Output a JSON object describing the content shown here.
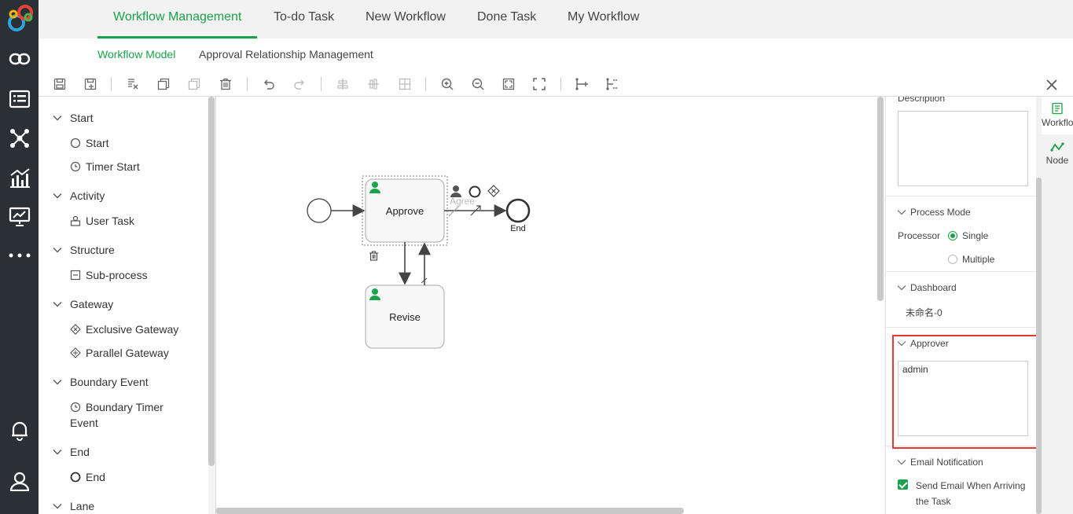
{
  "nav": {
    "tabs": [
      "Workflow Management",
      "To-do Task",
      "New Workflow",
      "Done Task",
      "My Workflow"
    ],
    "active_tab": "Workflow Management",
    "subtabs": [
      "Workflow Model",
      "Approval Relationship Management"
    ]
  },
  "palette": {
    "groups": [
      {
        "label": "Start",
        "items": [
          "Start",
          "Timer Start"
        ]
      },
      {
        "label": "Activity",
        "items": [
          "User Task"
        ]
      },
      {
        "label": "Structure",
        "items": [
          "Sub-process"
        ]
      },
      {
        "label": "Gateway",
        "items": [
          "Exclusive Gateway",
          "Parallel Gateway"
        ]
      },
      {
        "label": "Boundary Event",
        "items": [
          "Boundary Timer",
          "Event"
        ]
      },
      {
        "label": "End",
        "items": [
          "End"
        ]
      },
      {
        "label": "Lane",
        "items": []
      }
    ]
  },
  "diagram": {
    "task_approve": "Approve",
    "task_revise": "Revise",
    "flow_agree": "Agree",
    "end_label": "End"
  },
  "props": {
    "description_label": "Description",
    "description_value": "",
    "process_mode_title": "Process Mode",
    "processor_label": "Processor",
    "single": "Single",
    "multiple": "Multiple",
    "processor_selected": "Single",
    "dashboard_title": "Dashboard",
    "dashboard_value": "未命名-0",
    "approver_title": "Approver",
    "approver_value": "admin",
    "email_title": "Email Notification",
    "email_line1": "Send Email When Arriving",
    "email_line2": "the Task",
    "email_checked": true
  },
  "sidetabs": {
    "workflow": "Workflow",
    "node": "Node"
  },
  "colors": {
    "accent": "#1aa34a",
    "rail": "#2b2f36",
    "highlight": "#e53935"
  }
}
